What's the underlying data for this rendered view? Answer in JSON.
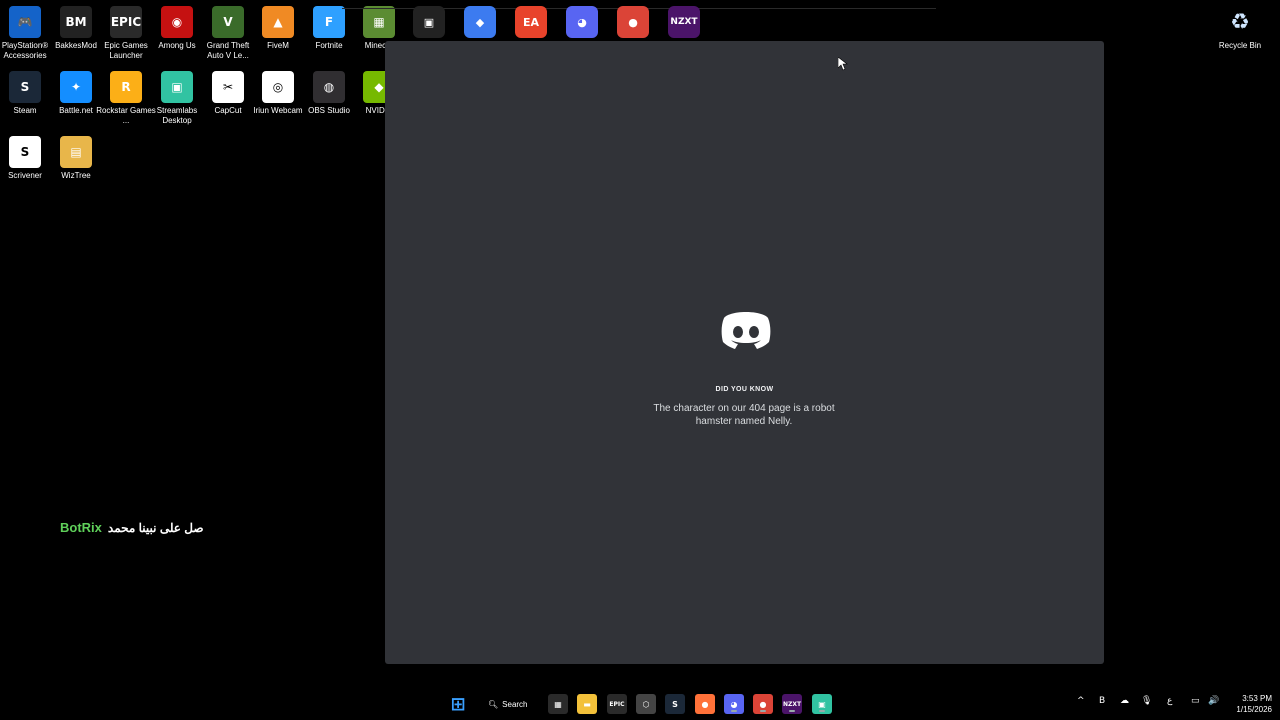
{
  "desktop_icons": [
    {
      "label": "PlayStation® Accessories",
      "glyph": "🎮",
      "color": "#1463c9"
    },
    {
      "label": "BakkesMod",
      "glyph": "BM",
      "color": "#222222"
    },
    {
      "label": "Epic Games Launcher",
      "glyph": "EPIC",
      "color": "#2a2a2a"
    },
    {
      "label": "Among Us",
      "glyph": "◉",
      "color": "#c51111"
    },
    {
      "label": "Grand Theft Auto V Le...",
      "glyph": "V",
      "color": "#3a6b2a"
    },
    {
      "label": "FiveM",
      "glyph": "▲",
      "color": "#f08a24"
    },
    {
      "label": "Fortnite",
      "glyph": "F",
      "color": "#2ea0ff"
    },
    {
      "label": "Minecra",
      "glyph": "▦",
      "color": "#5b8c32"
    },
    {
      "label": "Steam",
      "glyph": "S",
      "color": "#1b2838"
    },
    {
      "label": "Battle.net",
      "glyph": "✦",
      "color": "#148eff"
    },
    {
      "label": "Rockstar Games ...",
      "glyph": "R",
      "color": "#fcaf17"
    },
    {
      "label": "Streamlabs Desktop",
      "glyph": "▣",
      "color": "#31c3a2"
    },
    {
      "label": "CapCut",
      "glyph": "✂",
      "color": "#ffffff"
    },
    {
      "label": "Iriun Webcam",
      "glyph": "◎",
      "color": "#ffffff"
    },
    {
      "label": "OBS Studio",
      "glyph": "◍",
      "color": "#302e31"
    },
    {
      "label": "NVIDIA",
      "glyph": "◆",
      "color": "#76b900"
    },
    {
      "label": "Scrivener",
      "glyph": "S",
      "color": "#ffffff"
    },
    {
      "label": "WizTree",
      "glyph": "▤",
      "color": "#e8b64a"
    }
  ],
  "recycle_bin": {
    "label": "Recycle Bin",
    "glyph": "♻"
  },
  "top_icons": [
    {
      "name": "roblox-icon",
      "glyph": "▣",
      "color": "#222222"
    },
    {
      "name": "roblox-studio-icon",
      "glyph": "◆",
      "color": "#3c7bf0"
    },
    {
      "name": "ea-icon",
      "glyph": "EA",
      "color": "#e8432b"
    },
    {
      "name": "discord-icon",
      "glyph": "◕",
      "color": "#5865f2"
    },
    {
      "name": "chrome-icon",
      "glyph": "●",
      "color": "#db4437"
    },
    {
      "name": "nzxt-icon",
      "glyph": "NZXT",
      "color": "#4b1469"
    }
  ],
  "splash": {
    "heading": "DID YOU KNOW",
    "fact": "The character on our 404 page is a robot hamster named Nelly.",
    "bg": "#313338"
  },
  "overlay": {
    "brand": "BotRix",
    "arabic": "صل على نبينا محمد"
  },
  "taskbar": {
    "search_label": "Search",
    "apps": [
      {
        "name": "start-icon",
        "glyph": "⊞",
        "color": "#3aa0ff"
      },
      {
        "name": "store-icon",
        "glyph": "▦",
        "color": "#2a2a2a"
      },
      {
        "name": "file-explorer-icon",
        "glyph": "▬",
        "color": "#f3c13a"
      },
      {
        "name": "epic-icon",
        "glyph": "EPIC",
        "color": "#2a2a2a"
      },
      {
        "name": "unity-icon",
        "glyph": "⬡",
        "color": "#444444"
      },
      {
        "name": "steam-icon",
        "glyph": "S",
        "color": "#1b2838"
      },
      {
        "name": "firefox-icon",
        "glyph": "●",
        "color": "#ff7139"
      },
      {
        "name": "discord-icon",
        "glyph": "◕",
        "color": "#5865f2"
      },
      {
        "name": "chrome-icon",
        "glyph": "●",
        "color": "#db4437"
      },
      {
        "name": "nzxt-icon",
        "glyph": "NZXT",
        "color": "#4b1469"
      },
      {
        "name": "streamlabs-icon",
        "glyph": "▣",
        "color": "#31c3a2"
      }
    ],
    "tray": [
      "^",
      "B",
      "☁",
      "🎙",
      "ع",
      "▭",
      "🔊"
    ],
    "time": "3:53 PM",
    "date": "1/15/2026"
  }
}
